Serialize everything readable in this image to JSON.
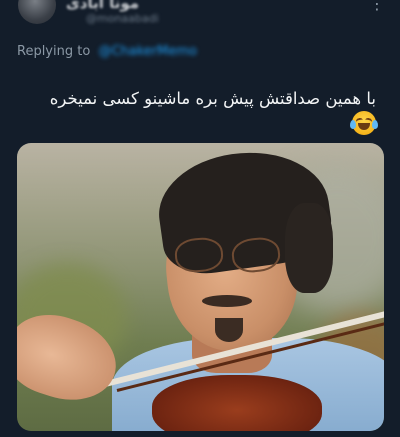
{
  "tweet": {
    "author_name": "مونا آبادی",
    "author_handle": "@monaabadi",
    "replying_label": "Replying to",
    "replying_handle": "@ChakerMemo",
    "text": "با همین صداقتش پیش بره ماشینو کسی نمیخره"
  },
  "icons": {
    "more": "more-options-icon",
    "emoji": "face-with-tears-of-joy-icon"
  },
  "media": {
    "description_kind": "photo"
  }
}
